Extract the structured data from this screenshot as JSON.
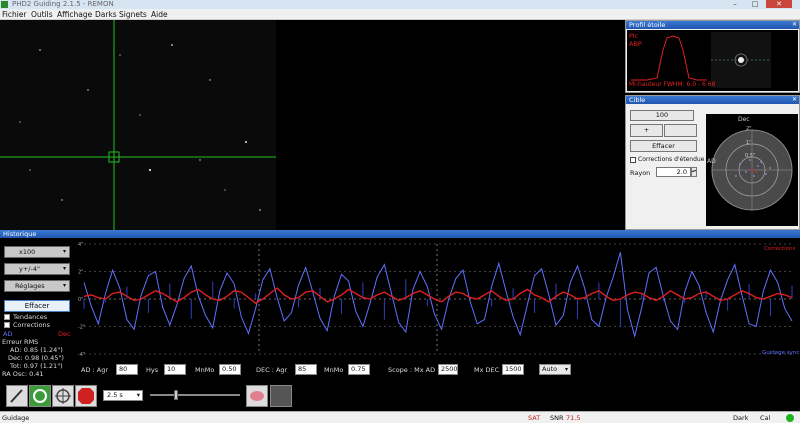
{
  "titlebar": {
    "title": "PHD2 Guiding 2.1.5 - REMON"
  },
  "menu": [
    "Fichier",
    "Outils",
    "Affichage",
    "Darks",
    "Signets",
    "Aide"
  ],
  "star_profile": {
    "title": "Profil étoile",
    "labels": [
      "Pic",
      "ABP"
    ],
    "footer": "Mi-hauteur FWHM: 6.0 - 6.68"
  },
  "target": {
    "title": "Cible",
    "scale_value": "100",
    "center_button": "Effacer",
    "checkbox_label": "Corrections d'étendue",
    "radius_label": "Rayon",
    "radius_value": "2.0",
    "target_labels": [
      "Dec",
      "AD",
      "2\"",
      "1\"",
      "0.5\""
    ]
  },
  "history": {
    "title": "Historique",
    "scale_combo": "x100",
    "yaxis_combo": "y+/-4\"",
    "adjust_combo": "Réglages",
    "clear_button": "Effacer",
    "trends_label": "Tendances",
    "corrections_label": "Corrections",
    "legend_ra": "AD",
    "legend_dec": "Dec",
    "rms_title": "Erreur RMS",
    "rms_ra": "AD: 0.85 (1.24\")",
    "rms_dec": "Dec: 0.98 (0.45\")",
    "rms_tot": "Tot: 0.97 (1.21\")",
    "ra_osc": "RA Osc: 0.41",
    "top_right": "Corrections",
    "bottom_right": "Guidage sync",
    "y_ticks": [
      "4\"",
      "2\"",
      "0\"",
      "-2\"",
      "-4\""
    ]
  },
  "params": {
    "ra_agr_label": "AD : Agr",
    "ra_agr": "80",
    "hys_label": "Hys",
    "hys": "10",
    "ra_minmo_label": "MnMo",
    "ra_minmo": "0.50",
    "dec_agr_label": "DEC : Agr",
    "dec_agr": "85",
    "dec_minmo_label": "MnMo",
    "dec_minmo": "0.75",
    "scope_label": "Scope : Mx AD",
    "scope_mx_ad": "2500",
    "mx_dec_label": "Mx DEC",
    "mx_dec": "1500",
    "mode": "Auto"
  },
  "toolbar": {
    "exposure": "2.5 s",
    "icons": [
      "loop-icon",
      "crosshair-icon",
      "stop-icon",
      "brain-icon",
      "camera-icon"
    ]
  },
  "status": {
    "left": "Guidage",
    "sat": "SAT",
    "snr_label": "SNR",
    "snr": "71.5",
    "dark": "Dark",
    "cal": "Cal"
  },
  "colors": {
    "ra_line": "#6070ff",
    "dec_line": "#e02020",
    "crosshair": "#20c020",
    "title_bar": "#1e56b0"
  },
  "chart_data": {
    "type": "line",
    "title": "",
    "xlabel": "",
    "ylabel": "",
    "ylim": [
      -4,
      4
    ],
    "series": [
      {
        "name": "AD",
        "values": [
          1.2,
          -0.5,
          -1.8,
          0.4,
          2.1,
          0.8,
          -1.5,
          -2.2,
          0.3,
          1.7,
          2.0,
          -0.6,
          -1.9,
          -0.4,
          1.5,
          2.4,
          0.2,
          -1.2,
          -2.1,
          0.6,
          1.9,
          1.1,
          -1.3,
          -2.5,
          -0.7,
          1.4,
          2.2,
          0.1,
          -1.6,
          -1.0,
          1.0,
          2.3,
          0.5,
          -1.4,
          -2.3,
          0.2,
          1.8,
          1.3,
          -0.9,
          -2.0,
          -0.3,
          1.6,
          2.5,
          0.4,
          -1.7,
          -2.4,
          0.7,
          2.0,
          0.9,
          -1.1,
          -2.2,
          0.0,
          1.5,
          2.1,
          -0.2,
          -1.8,
          -1.5,
          0.9,
          2.6,
          0.6,
          -1.3,
          -2.6,
          -0.4,
          1.7,
          2.2,
          0.3,
          -1.9,
          -1.2,
          1.2,
          2.4,
          0.8,
          -1.5,
          -2.0,
          0.1,
          1.6,
          3.4,
          -0.8,
          -2.7,
          -0.6,
          1.9,
          2.3,
          0.2,
          -1.6,
          -2.2,
          0.5,
          2.0,
          1.0,
          -1.0,
          -2.4,
          -0.1,
          1.4,
          2.5,
          0.3,
          -1.8,
          -2.0,
          0.6,
          2.1,
          1.2,
          -0.7,
          -1.6
        ]
      },
      {
        "name": "Dec",
        "values": [
          0.2,
          0.3,
          0.1,
          0.0,
          0.4,
          0.5,
          0.2,
          -0.1,
          0.0,
          0.3,
          0.6,
          0.4,
          0.1,
          -0.2,
          0.1,
          0.5,
          0.7,
          0.3,
          0.0,
          -0.1,
          0.2,
          0.6,
          0.5,
          0.1,
          -0.3,
          0.0,
          0.4,
          0.8,
          0.3,
          0.0,
          0.1,
          0.5,
          0.6,
          0.2,
          -0.2,
          0.0,
          0.3,
          0.7,
          0.4,
          0.1,
          0.0,
          0.3,
          0.5,
          0.2,
          -0.1,
          0.1,
          0.4,
          0.6,
          0.3,
          0.0,
          -0.2,
          0.2,
          0.5,
          0.4,
          0.1,
          0.0,
          0.3,
          0.6,
          0.2,
          -0.1,
          0.0,
          0.4,
          0.7,
          0.3,
          0.1,
          -0.2,
          0.2,
          0.5,
          0.3,
          0.0,
          0.1,
          0.4,
          0.6,
          0.2,
          -0.1,
          0.0,
          0.3,
          0.5,
          0.4,
          0.1,
          -0.1,
          0.2,
          0.6,
          0.3,
          0.0,
          0.1,
          0.4,
          0.5,
          0.2,
          -0.1,
          0.0,
          0.3,
          0.6,
          0.4,
          0.1,
          0.0,
          0.2,
          0.4,
          0.3,
          0.1
        ]
      }
    ]
  }
}
